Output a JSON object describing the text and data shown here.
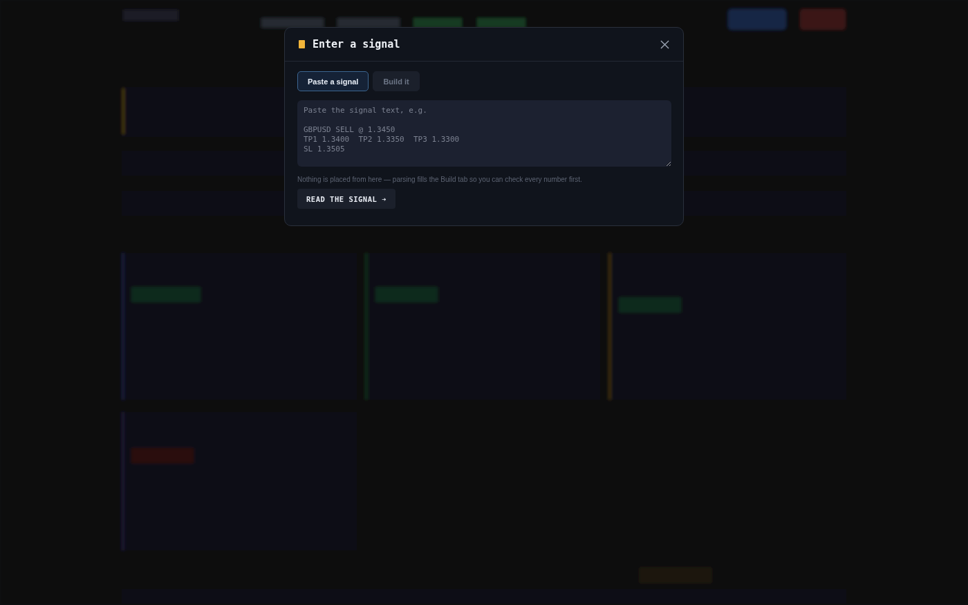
{
  "dialog": {
    "title": "Enter a signal",
    "tabs": [
      {
        "label": "Paste a signal",
        "selected": true
      },
      {
        "label": "Build it",
        "selected": false
      }
    ],
    "signal_field": {
      "placeholder": "Paste the signal text, e.g.\n\nGBPUSD SELL @ 1.3450\nTP1 1.3400  TP2 1.3350  TP3 1.3300\nSL 1.3505"
    },
    "hint": "Nothing is placed from here — parsing fills the Build tab so you can check every number first.",
    "button": "READ THE SIGNAL ➔"
  }
}
